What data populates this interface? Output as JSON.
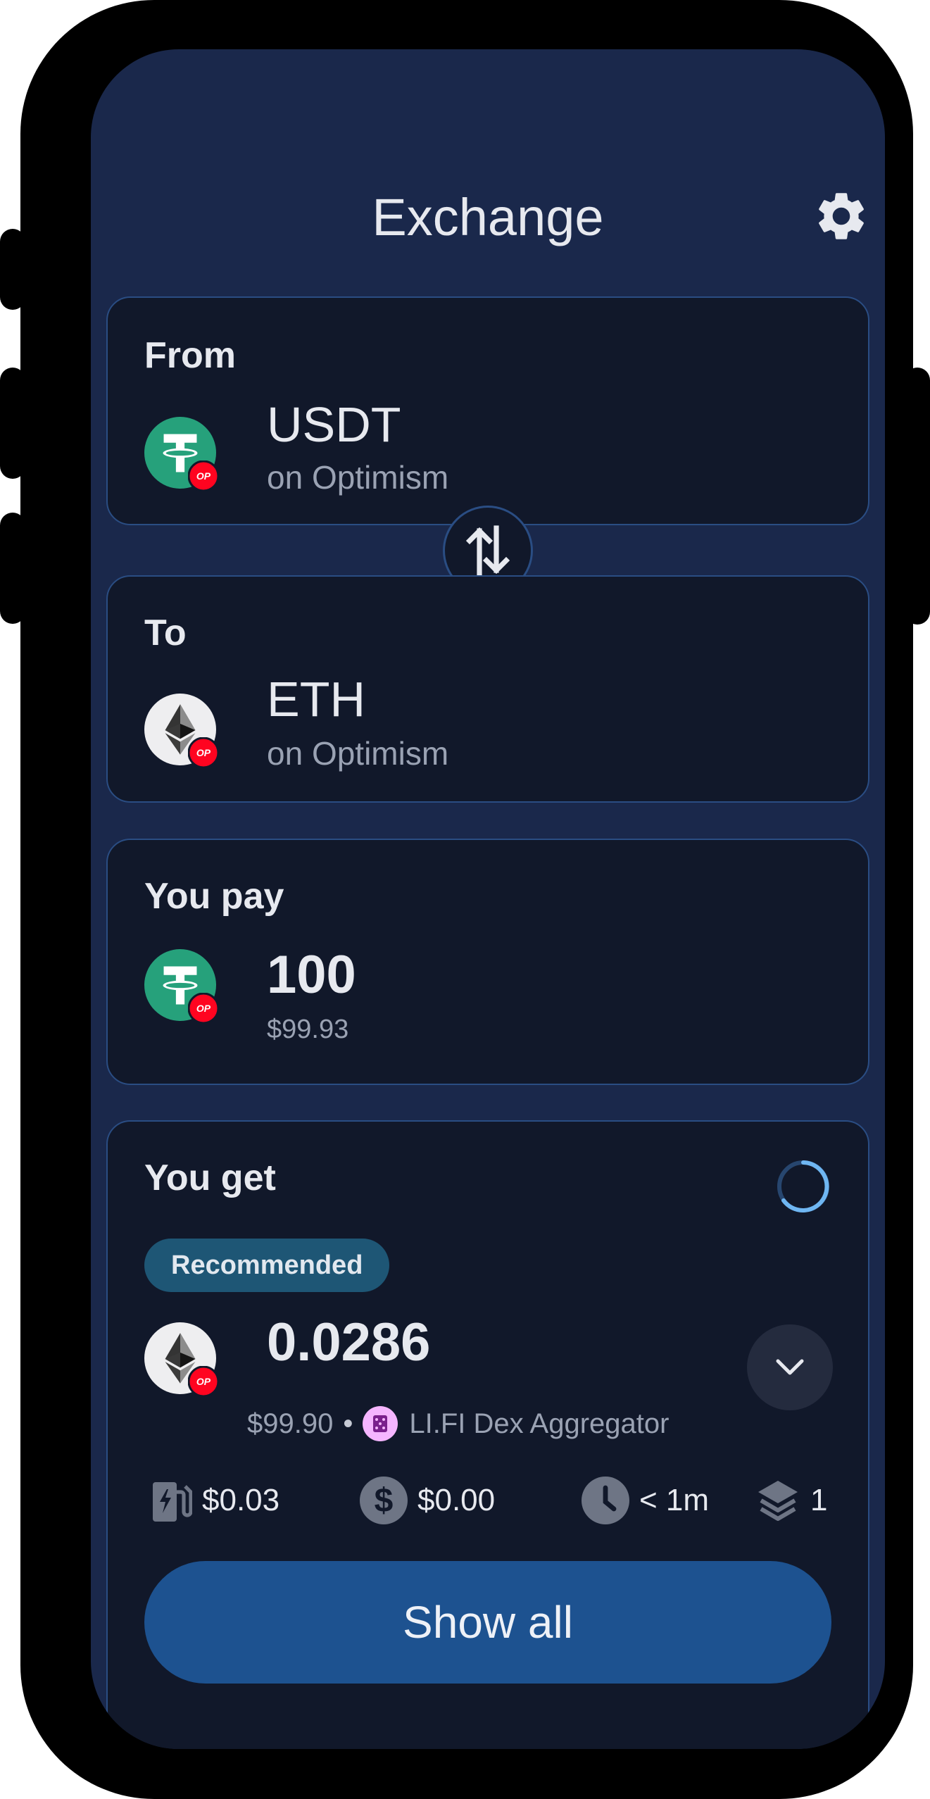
{
  "header": {
    "title": "Exchange",
    "settings_icon": "gear-icon"
  },
  "from": {
    "label": "From",
    "token": "USDT",
    "chain": "on Optimism",
    "token_icon": "tether-icon",
    "chain_badge": "optimism-icon",
    "badge_text": "OP"
  },
  "swap_icon": "swap-arrows-icon",
  "to": {
    "label": "To",
    "token": "ETH",
    "chain": "on Optimism",
    "token_icon": "ethereum-icon",
    "chain_badge": "optimism-icon",
    "badge_text": "OP"
  },
  "pay": {
    "label": "You pay",
    "amount": "100",
    "usd": "$99.93",
    "badge_text": "OP"
  },
  "get": {
    "label": "You get",
    "badge": "Recommended",
    "amount": "0.0286",
    "usd": "$99.90",
    "separator": "•",
    "provider": "LI.FI Dex Aggregator",
    "badge_text": "OP",
    "stats": {
      "gas": "$0.03",
      "fee": "$0.00",
      "time": "< 1m",
      "steps": "1"
    },
    "show_all": "Show all"
  },
  "colors": {
    "screen_bg": "#1a284b",
    "card_bg": "#11182a",
    "card_border": "#2a4d83",
    "accent_button": "#1d5290",
    "tether_green": "#26a17b",
    "optimism_red": "#ff0420",
    "recommended_bg": "#1e5675"
  }
}
